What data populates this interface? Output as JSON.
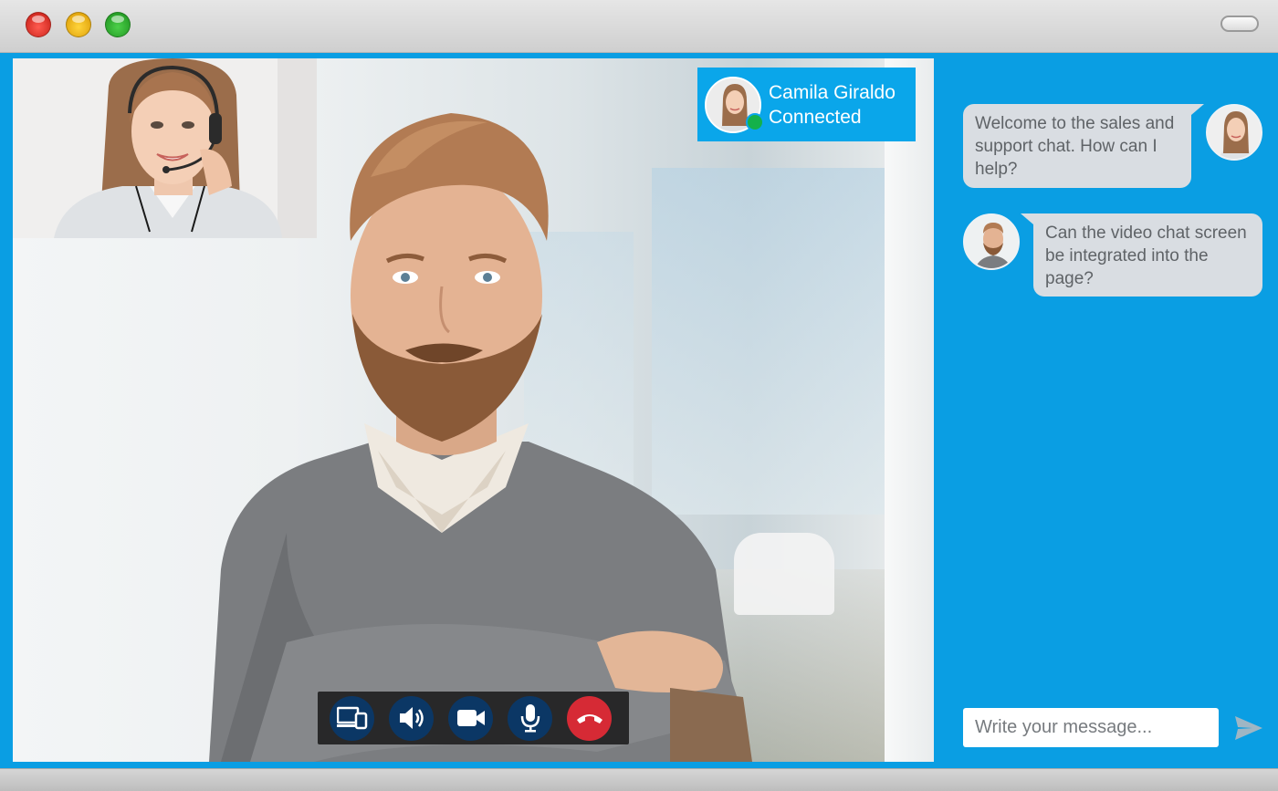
{
  "contact": {
    "name": "Camila Giraldo",
    "status": "Connected",
    "status_color": "#14b14a"
  },
  "chat": {
    "messages": [
      {
        "from": "agent",
        "text": "Welcome to the sales and support chat. How can I help?"
      },
      {
        "from": "user",
        "text": "Can the video chat screen be integrated into the page?"
      }
    ],
    "input_placeholder": "Write your message..."
  },
  "controls": [
    {
      "icon": "screen-share-icon"
    },
    {
      "icon": "speaker-icon"
    },
    {
      "icon": "camera-icon"
    },
    {
      "icon": "microphone-icon"
    },
    {
      "icon": "hang-up-icon"
    }
  ],
  "colors": {
    "accent": "#0a9ee3",
    "control_bg": "#0b3765",
    "hangup": "#d62a35",
    "bubble": "#d9dde2"
  }
}
